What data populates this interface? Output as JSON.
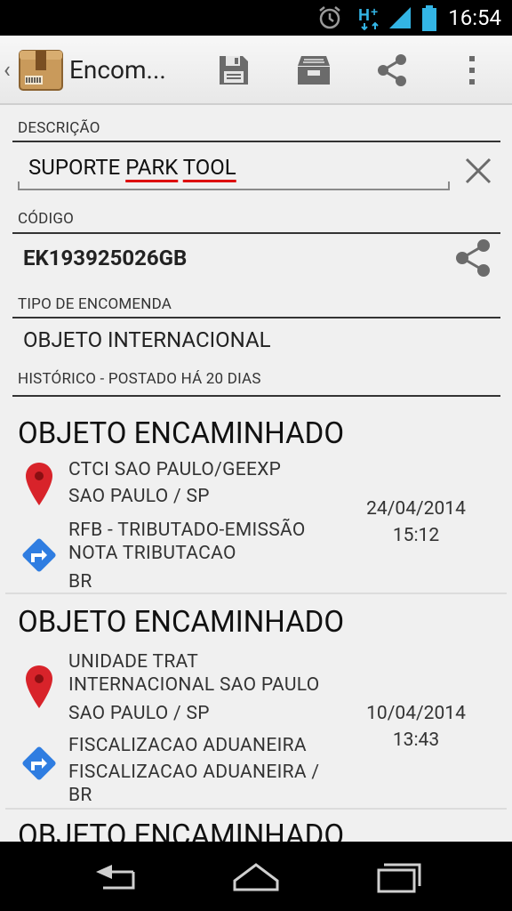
{
  "status_bar": {
    "time": "16:54",
    "icons": [
      "alarm-icon",
      "network-hplus-icon",
      "signal-icon",
      "battery-icon"
    ]
  },
  "action_bar": {
    "title": "Encom...",
    "actions": [
      "save-icon",
      "archive-icon",
      "share-icon",
      "overflow-menu-icon"
    ]
  },
  "form": {
    "description_label": "DESCRIÇÃO",
    "description_value_prefix": "SUPORTE ",
    "description_value_word1": "PARK",
    "description_value_space": " ",
    "description_value_word2": "TOOL",
    "code_label": "CÓDIGO",
    "code_value": "EK193925026GB",
    "type_label": "TIPO DE ENCOMENDA",
    "type_value": "OBJETO INTERNACIONAL",
    "history_label": "HISTÓRICO - POSTADO HÁ 20 DIAS"
  },
  "events": [
    {
      "title": "OBJETO ENCAMINHADO",
      "origin_line1": "CTCI SAO PAULO/GEEXP",
      "origin_line2": "SAO PAULO / SP",
      "dest_line1": "RFB - TRIBUTADO-EMISSÃO",
      "dest_line2": "NOTA TRIBUTACAO",
      "dest_line3": "BR",
      "date": "24/04/2014",
      "time": "15:12"
    },
    {
      "title": "OBJETO ENCAMINHADO",
      "origin_line1": "UNIDADE TRAT",
      "origin_line2": "INTERNACIONAL SAO PAULO",
      "origin_line3": "SAO PAULO / SP",
      "dest_line1": "FISCALIZACAO ADUANEIRA",
      "dest_line2": "FISCALIZACAO ADUANEIRA /",
      "dest_line3": "BR",
      "date": "10/04/2014",
      "time": "13:43"
    },
    {
      "title": "OBJETO ENCAMINHADO"
    }
  ],
  "colors": {
    "pin_red": "#d8232a",
    "direction_blue": "#2f7de1",
    "clipboard_brown": "#b98a4f"
  }
}
